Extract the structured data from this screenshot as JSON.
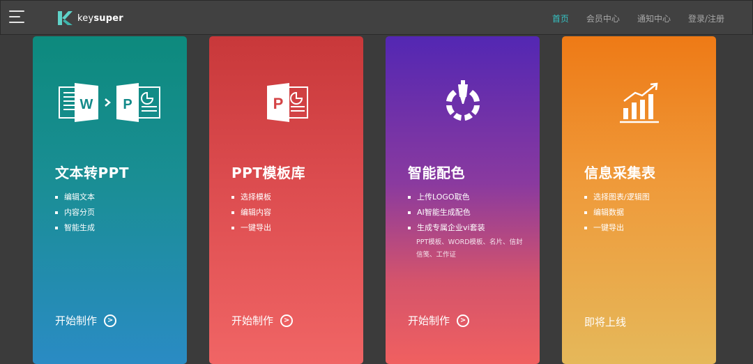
{
  "header": {
    "brand": {
      "prefix": "key",
      "suffix": "super"
    },
    "nav": [
      {
        "label": "首页",
        "active": true
      },
      {
        "label": "会员中心",
        "active": false
      },
      {
        "label": "通知中心",
        "active": false
      },
      {
        "label": "登录/注册",
        "active": false
      }
    ]
  },
  "cards": [
    {
      "title": "文本转PPT",
      "icon": "word-to-ppt-icon",
      "features": [
        "编辑文本",
        "内容分页",
        "智能生成"
      ],
      "cta": "开始制作"
    },
    {
      "title": "PPT模板库",
      "icon": "ppt-icon",
      "features": [
        "选择模板",
        "编辑内容",
        "一键导出"
      ],
      "cta": "开始制作"
    },
    {
      "title": "智能配色",
      "icon": "color-picker-icon",
      "features": [
        "上传LOGO取色",
        "AI智能生成配色",
        "生成专属企业vi套装"
      ],
      "note": "PPT模板、WORD模板、名片、信封信笺、工作证",
      "cta": "开始制作"
    },
    {
      "title": "信息采集表",
      "icon": "bar-chart-icon",
      "features": [
        "选择图表/逻辑图",
        "编辑数据",
        "一键导出"
      ],
      "status": "即将上线"
    }
  ],
  "colors": {
    "accent": "#35c3c4",
    "header_bg": "#414141",
    "page_bg": "#3b3b3b"
  }
}
